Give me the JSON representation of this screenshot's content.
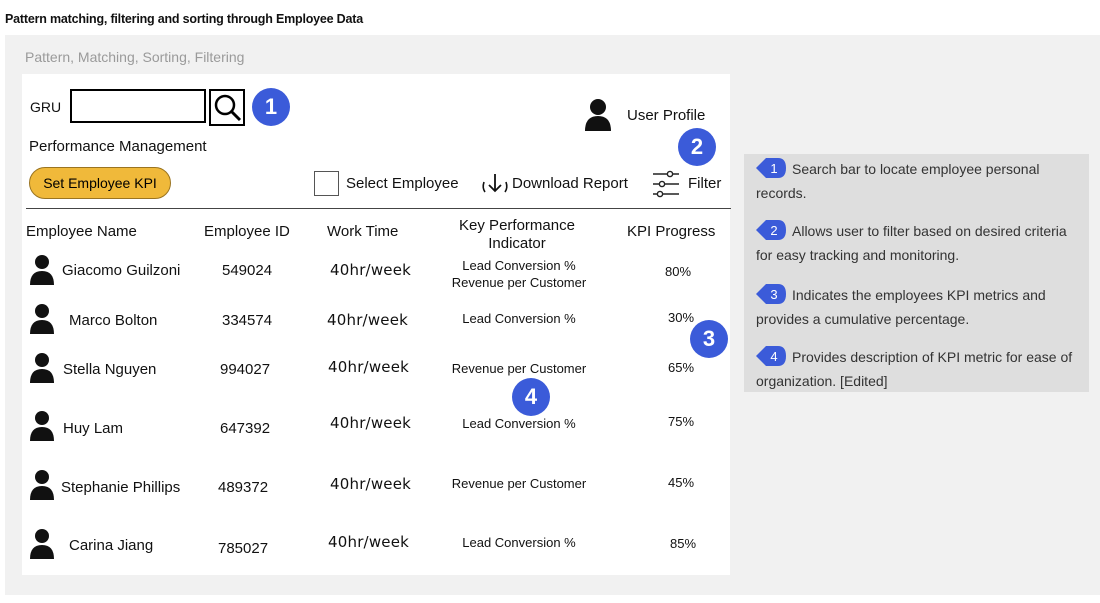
{
  "page_title": "Pattern matching, filtering and sorting through Employee Data",
  "frame_label": "Pattern, Matching, Sorting, Filtering",
  "header": {
    "search_label": "GRU",
    "search_value": "",
    "user_profile": "User Profile",
    "section_title": "Performance Management"
  },
  "toolbar": {
    "set_kpi_button": "Set Employee KPI",
    "select_employee": "Select Employee",
    "download_report": "Download Report",
    "filter": "Filter"
  },
  "table": {
    "columns": [
      "Employee Name",
      "Employee ID",
      "Work Time",
      "Key Performance Indicator",
      "KPI Progress"
    ],
    "rows": [
      {
        "name": "Giacomo Guilzoni",
        "id": "549024",
        "work_time": "40hr/week",
        "kpi": "Lead Conversion %\nRevenue per Customer",
        "progress": "80%"
      },
      {
        "name": "Marco Bolton",
        "id": "334574",
        "work_time": "40hr/week",
        "kpi": "Lead Conversion %",
        "progress": "30%"
      },
      {
        "name": "Stella Nguyen",
        "id": "994027",
        "work_time": "40hr/week",
        "kpi": "Revenue per Customer",
        "progress": "65%"
      },
      {
        "name": "Huy Lam",
        "id": "647392",
        "work_time": "40hr/week",
        "kpi": "Lead Conversion %",
        "progress": "75%"
      },
      {
        "name": "Stephanie Phillips",
        "id": "489372",
        "work_time": "40hr/week",
        "kpi": "Revenue per Customer",
        "progress": "45%"
      },
      {
        "name": "Carina Jiang",
        "id": "785027",
        "work_time": "40hr/week",
        "kpi": "Lead Conversion %",
        "progress": "85%"
      }
    ]
  },
  "badges": [
    "1",
    "2",
    "3",
    "4"
  ],
  "annotations": [
    {
      "num": "1",
      "text": "Search bar to locate  employee personal records."
    },
    {
      "num": "2",
      "text": "Allows user to filter based on desired criteria for easy tracking and monitoring."
    },
    {
      "num": "3",
      "text": "Indicates the employees KPI metrics and provides a cumulative percentage."
    },
    {
      "num": "4",
      "text": "Provides description of KPI metric for ease of organization.  [Edited]"
    }
  ],
  "colors": {
    "accent_button": "#f0b93a",
    "badge": "#3b5bd9"
  },
  "icons": [
    "search-icon",
    "user-icon",
    "download-icon",
    "filter-icon",
    "avatar-icon"
  ]
}
